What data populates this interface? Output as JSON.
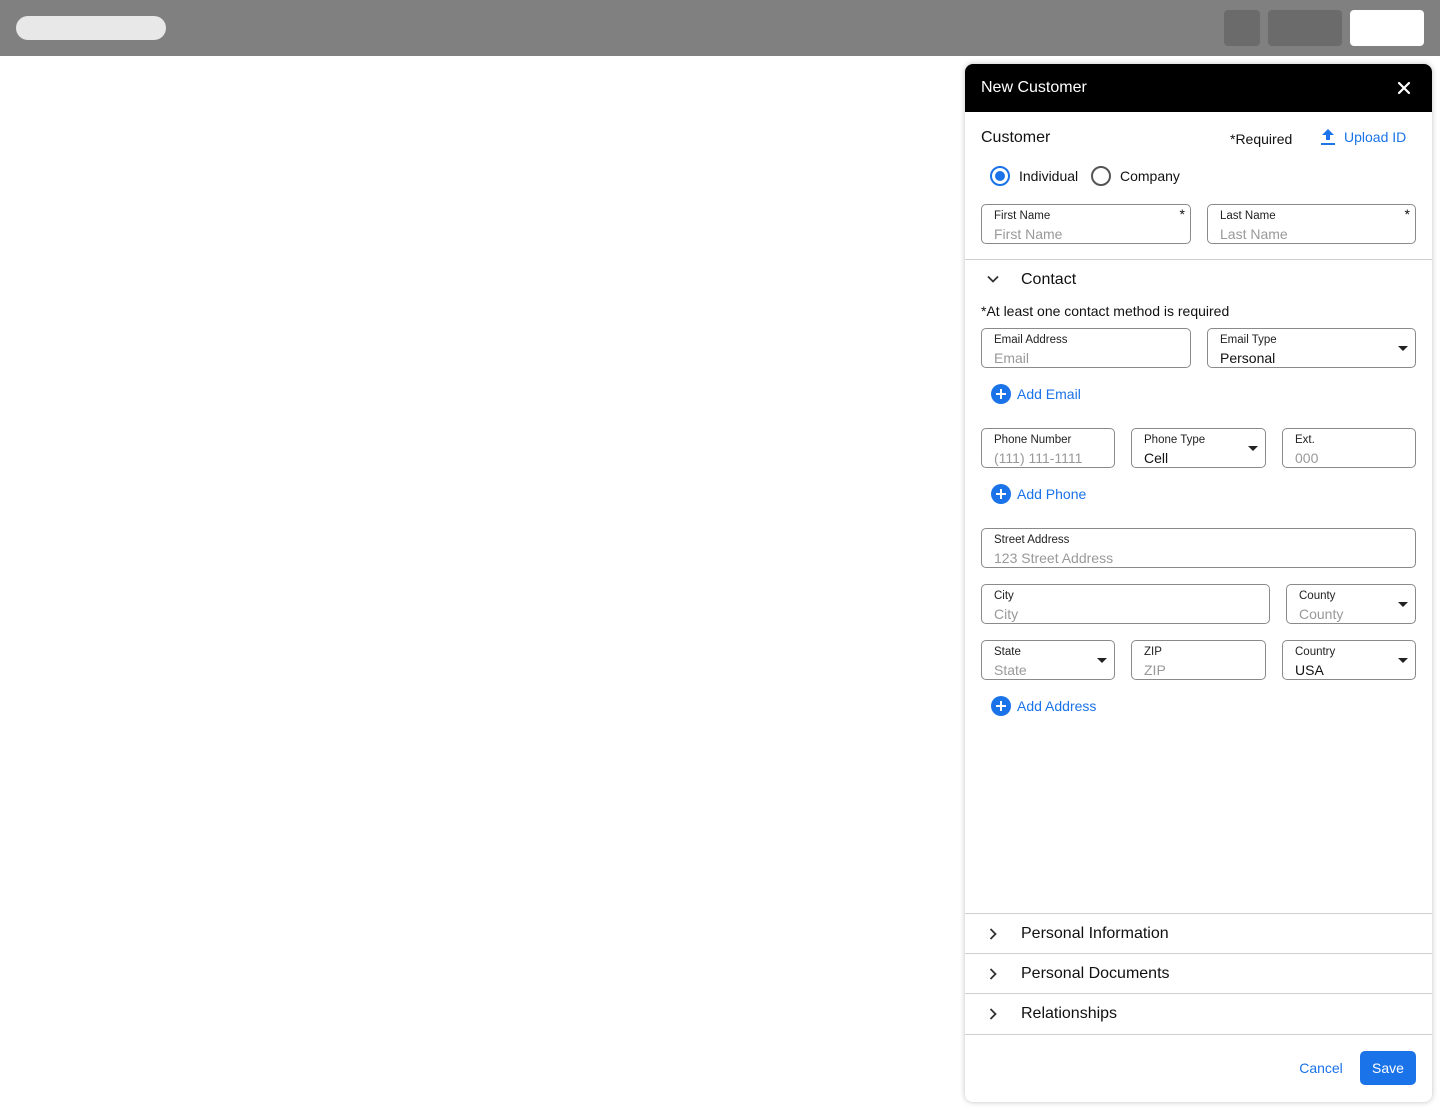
{
  "panel": {
    "title": "New Customer",
    "customer_section": {
      "title": "Customer",
      "required_note": "*Required",
      "upload_label": "Upload ID",
      "customer_types": [
        "Individual",
        "Company"
      ],
      "selected_type": "Individual",
      "first_name": {
        "label": "First Name",
        "placeholder": "First Name",
        "required_mark": "*"
      },
      "last_name": {
        "label": "Last Name",
        "placeholder": "Last Name",
        "required_mark": "*"
      }
    },
    "contact": {
      "title": "Contact",
      "note": "*At least one contact method is required",
      "email": {
        "label": "Email Address",
        "placeholder": "Email"
      },
      "email_type": {
        "label": "Email Type",
        "value": "Personal"
      },
      "add_email": "Add Email",
      "phone": {
        "label": "Phone Number",
        "placeholder": "(111) 111-1111"
      },
      "phone_type": {
        "label": "Phone Type",
        "value": "Cell"
      },
      "ext": {
        "label": "Ext.",
        "placeholder": "000"
      },
      "add_phone": "Add Phone",
      "street": {
        "label": "Street Address",
        "placeholder": "123 Street Address"
      },
      "city": {
        "label": "City",
        "placeholder": "City"
      },
      "county": {
        "label": "County",
        "placeholder": "County"
      },
      "state": {
        "label": "State",
        "placeholder": "State"
      },
      "zip": {
        "label": "ZIP",
        "placeholder": "ZIP"
      },
      "country": {
        "label": "Country",
        "value": "USA"
      },
      "add_address": "Add Address"
    },
    "collapsed_sections": [
      "Personal Information",
      "Personal Documents",
      "Relationships"
    ],
    "footer": {
      "cancel": "Cancel",
      "save": "Save"
    }
  },
  "colors": {
    "accent": "#1a73e8",
    "header_bg": "#000000",
    "topbar_bg": "#808080"
  },
  "icons": {
    "close": "close-icon",
    "upload": "upload-icon",
    "expanded": "chevron-down-icon",
    "collapsed": "chevron-right-icon",
    "add": "plus-circle-icon"
  }
}
